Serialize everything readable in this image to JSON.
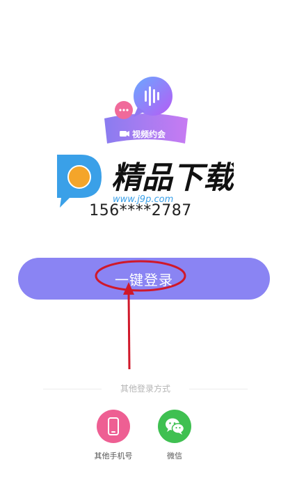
{
  "app_logo": {
    "label": "视频约会",
    "icon": "chat-bubbles-video-icon"
  },
  "watermark": {
    "brand": "精品下载",
    "url": "www.j9p.com",
    "icon": "p-logo-icon"
  },
  "phone_masked": "156****2787",
  "login_button": {
    "label": "一键登录"
  },
  "other_methods": {
    "title": "其他登录方式",
    "options": [
      {
        "label": "其他手机号",
        "icon": "mobile-phone-icon",
        "color": "#ee5f93"
      },
      {
        "label": "微信",
        "icon": "wechat-icon",
        "color": "#3fc051"
      }
    ]
  },
  "colors": {
    "primary": "#8a84f3",
    "annotation": "#d0182a"
  }
}
